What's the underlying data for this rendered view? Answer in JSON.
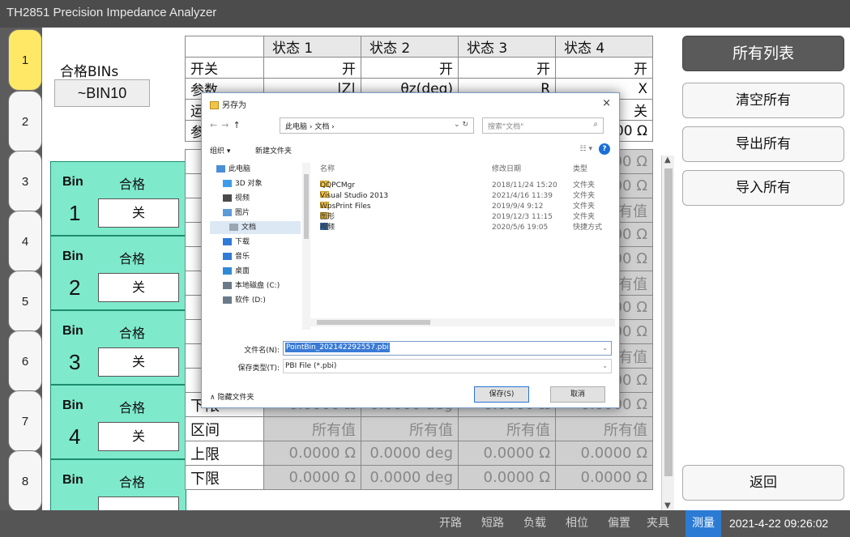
{
  "app": {
    "title": "TH2851 Precision Impedance Analyzer"
  },
  "tabs": [
    "1",
    "2",
    "3",
    "4",
    "5",
    "6",
    "7",
    "8"
  ],
  "summary": {
    "label": "合格BINs",
    "value": "~BIN10"
  },
  "state_table": {
    "headers": [
      "状态 1",
      "状态 2",
      "状态 3",
      "状态 4"
    ],
    "rows": [
      {
        "label": "开关",
        "values": [
          "开",
          "开",
          "开",
          "开"
        ]
      },
      {
        "label": "参数",
        "values": [
          "|Z|",
          "θz(deg)",
          "R",
          "X"
        ]
      },
      {
        "label": "运",
        "values": [
          "",
          "",
          "",
          "关"
        ]
      },
      {
        "label": "参",
        "values": [
          "",
          "",
          "",
          "00 Ω"
        ]
      }
    ]
  },
  "bins": [
    {
      "key": "Bin",
      "number": "1",
      "pass_label": "合格",
      "toggle": "关"
    },
    {
      "key": "Bin",
      "number": "2",
      "pass_label": "合格",
      "toggle": "关"
    },
    {
      "key": "Bin",
      "number": "3",
      "pass_label": "合格",
      "toggle": "关"
    },
    {
      "key": "Bin",
      "number": "4",
      "pass_label": "合格",
      "toggle": "关"
    },
    {
      "key": "Bin",
      "number": "",
      "pass_label": "合格",
      "toggle": ""
    }
  ],
  "limit_rows": [
    {
      "label": "",
      "values": [
        "",
        "",
        "",
        "00 Ω"
      ]
    },
    {
      "label": "",
      "values": [
        "",
        "",
        "",
        "00 Ω"
      ]
    },
    {
      "label": "",
      "values": [
        "",
        "",
        "",
        "有值"
      ]
    },
    {
      "label": "",
      "values": [
        "",
        "",
        "",
        "00 Ω"
      ]
    },
    {
      "label": "",
      "values": [
        "",
        "",
        "",
        "00 Ω"
      ]
    },
    {
      "label": "",
      "values": [
        "",
        "",
        "",
        "有值"
      ]
    },
    {
      "label": "",
      "values": [
        "",
        "",
        "",
        "00 Ω"
      ]
    },
    {
      "label": "",
      "values": [
        "",
        "",
        "",
        "00 Ω"
      ]
    },
    {
      "label": "",
      "values": [
        "",
        "",
        "",
        "有值"
      ]
    },
    {
      "label": "",
      "values": [
        "",
        "",
        "",
        "00 Ω"
      ]
    },
    {
      "label": "下限",
      "values": [
        "0.0000 Ω",
        "0.0000 deg",
        "0.0000 Ω",
        "0.0000 Ω"
      ]
    },
    {
      "label": "区间",
      "values": [
        "所有值",
        "所有值",
        "所有值",
        "所有值"
      ]
    },
    {
      "label": "上限",
      "values": [
        "0.0000 Ω",
        "0.0000 deg",
        "0.0000 Ω",
        "0.0000 Ω"
      ]
    },
    {
      "label": "下限",
      "values": [
        "0.0000 Ω",
        "0.0000 deg",
        "0.0000 Ω",
        "0.0000 Ω"
      ]
    }
  ],
  "right_panel": {
    "title": "所有列表",
    "clear": "清空所有",
    "export": "导出所有",
    "import": "导入所有",
    "back": "返回"
  },
  "status_bar": {
    "items": [
      "开路",
      "短路",
      "负载",
      "相位",
      "偏置",
      "夹具",
      "测量"
    ],
    "active": "测量",
    "active_color": "#2b7bd4",
    "datetime": "2021-4-22 09:26:02"
  },
  "dialog": {
    "title": "另存为",
    "close": "×",
    "breadcrumb": "此电脑 › 文档 ›",
    "search_placeholder": "搜索\"文档\"",
    "toolbar": {
      "organize": "组织 ▾",
      "new_folder": "新建文件夹"
    },
    "nav_items": [
      {
        "label": "此电脑",
        "icon": "computer-icon",
        "color": "#4a8fd6"
      },
      {
        "label": "3D 对象",
        "icon": "cube-icon",
        "color": "#3d9be9"
      },
      {
        "label": "视频",
        "icon": "video-icon",
        "color": "#4a4a4a"
      },
      {
        "label": "图片",
        "icon": "picture-icon",
        "color": "#5c9bd6"
      },
      {
        "label": "文档",
        "icon": "document-icon",
        "color": "#9aa6b2",
        "selected": true
      },
      {
        "label": "下载",
        "icon": "download-icon",
        "color": "#2f7bd6"
      },
      {
        "label": "音乐",
        "icon": "music-icon",
        "color": "#2f7bd6"
      },
      {
        "label": "桌面",
        "icon": "desktop-icon",
        "color": "#2f8ad6"
      },
      {
        "label": "本地磁盘 (C:)",
        "icon": "disk-icon",
        "color": "#6b7a88"
      },
      {
        "label": "软件 (D:)",
        "icon": "disk-icon",
        "color": "#6b7a88"
      }
    ],
    "columns": {
      "name": "名称",
      "modified": "修改日期",
      "type": "类型"
    },
    "files": [
      {
        "name": "QQPCMgr",
        "date": "2018/11/24 15:20",
        "type": "文件夹",
        "icon": "folder-icon"
      },
      {
        "name": "Visual Studio 2013",
        "date": "2021/4/16 11:39",
        "type": "文件夹",
        "icon": "folder-icon"
      },
      {
        "name": "WpsPrint Files",
        "date": "2019/9/4 9:12",
        "type": "文件夹",
        "icon": "folder-icon"
      },
      {
        "name": "图形",
        "date": "2019/12/3 11:15",
        "type": "文件夹",
        "icon": "folder-icon"
      },
      {
        "name": "视频",
        "date": "2020/5/6 19:05",
        "type": "快捷方式",
        "icon": "shortcut-icon"
      }
    ],
    "filename_label": "文件名(N):",
    "filename_value": "PointBin_202142292557.pbi",
    "filetype_label": "保存类型(T):",
    "filetype_value": "PBI File (*.pbi)",
    "hide_folders": "∧ 隐藏文件夹",
    "save_label": "保存(S)",
    "cancel_label": "取消"
  }
}
